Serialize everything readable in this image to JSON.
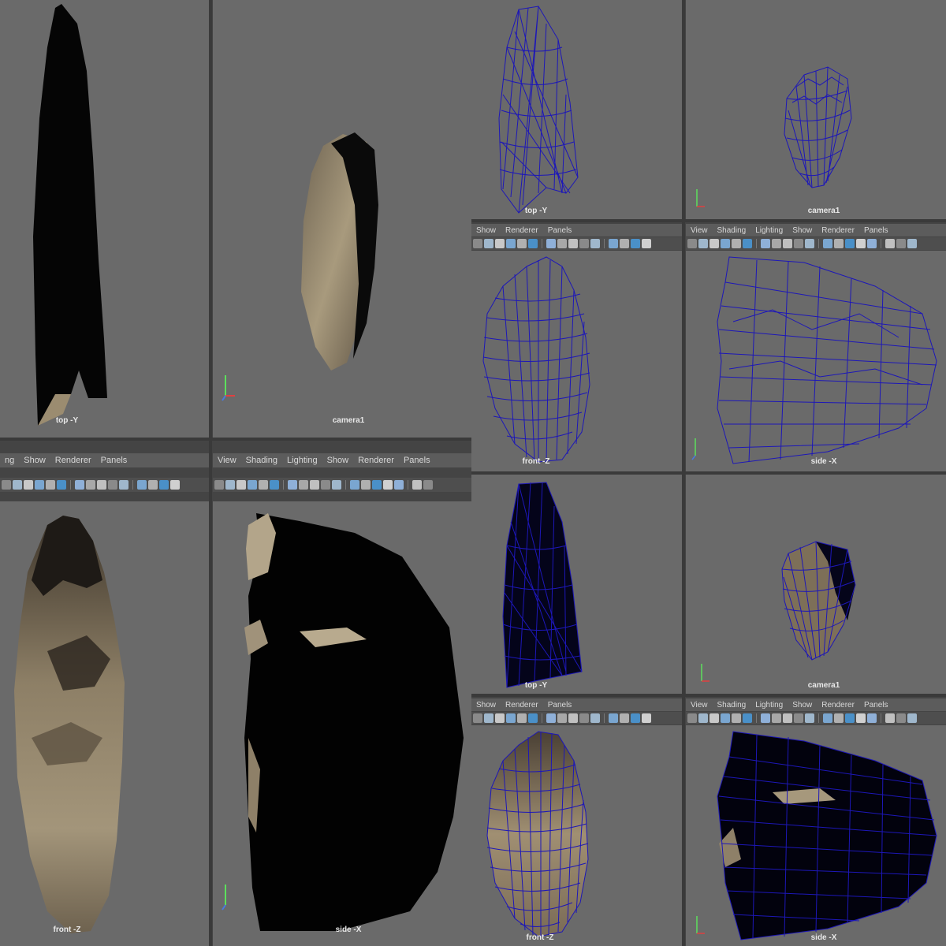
{
  "menu": {
    "view": "View",
    "shading": "Shading",
    "lighting": "Lighting",
    "show": "Show",
    "renderer": "Renderer",
    "panels": "Panels",
    "ng_show": "ng",
    "cut_show": "Show"
  },
  "labels": {
    "top": "top -Y",
    "camera": "camera1",
    "front": "front -Z",
    "side": "side -X"
  },
  "colors": {
    "viewport_bg": "#6a6a6a",
    "wireframe": "#1d17b8",
    "rock_light": "#a79a80",
    "rock_dark": "#2a2520",
    "toolbar_bg": "#4e4e4e",
    "toolbar_active": "#4a90c8"
  },
  "icons": [
    "select-icon",
    "lasso-icon",
    "paint-icon",
    "grid-icon",
    "wireframe-icon",
    "shaded-icon",
    "textured-icon",
    "light-icon",
    "xray-icon",
    "isolate-icon"
  ]
}
